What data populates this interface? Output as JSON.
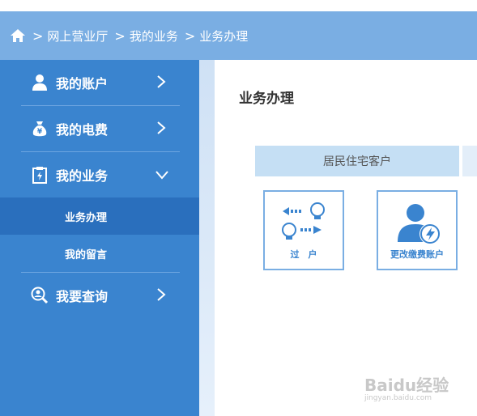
{
  "breadcrumb": {
    "items": [
      "网上营业厅",
      "我的业务",
      "业务办理"
    ]
  },
  "sidebar": {
    "items": [
      {
        "label": "我的账户",
        "icon": "user-icon"
      },
      {
        "label": "我的电费",
        "icon": "money-bag-icon"
      },
      {
        "label": "我的业务",
        "icon": "clipboard-icon"
      },
      {
        "label": "我要查询",
        "icon": "search-person-icon"
      }
    ],
    "sub_items": [
      "业务办理",
      "我的留言"
    ]
  },
  "main": {
    "title": "业务办理",
    "tab_label": "居民住宅客户",
    "cards": [
      {
        "label": "过　户",
        "icon": "transfer-bulb-icon"
      },
      {
        "label": "更改缴费账户",
        "icon": "user-lightning-icon"
      }
    ]
  },
  "watermark": {
    "brand": "Baidu经验",
    "url": "jingyan.baidu.com"
  },
  "colors": {
    "topbar": "#7aaee3",
    "sidebar": "#3a84cf",
    "sidebar_active": "#2a6fbd",
    "tab": "#c5dff4",
    "card_border": "#7aaee3"
  }
}
